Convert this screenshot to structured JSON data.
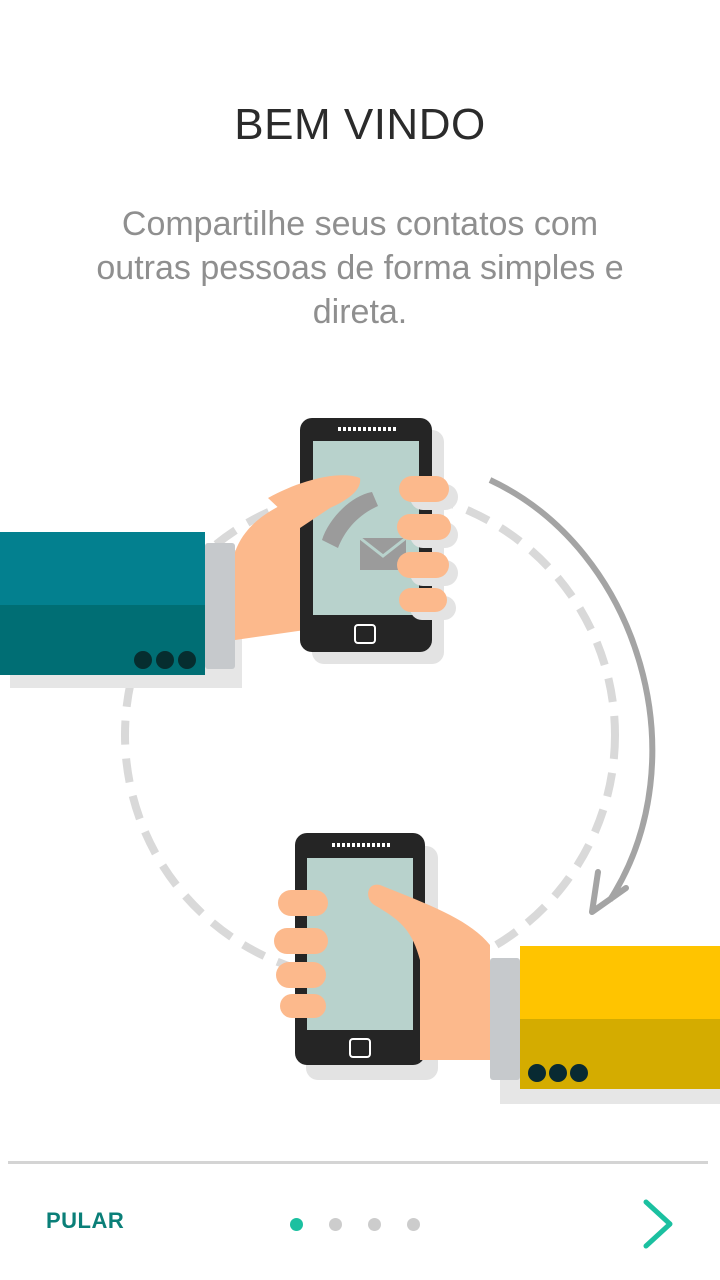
{
  "onboarding": {
    "title": "BEM VINDO",
    "description": "Compartilhe seus contatos com outras pessoas de forma simples e direta.",
    "current_page": 1,
    "total_pages": 4
  },
  "footer": {
    "skip_label": "PULAR"
  },
  "colors": {
    "accent": "#1bc0a0",
    "skip_text": "#0a7f78",
    "teal_sleeve": "#0a7f8c",
    "yellow_sleeve": "#ffc400",
    "skin": "#fcb98c",
    "phone_body": "#2b2b2b",
    "phone_screen": "#b8d2cc"
  },
  "icons": {
    "illustration": "hands-sharing-phones-illustration",
    "next": "chevron-right-icon"
  }
}
